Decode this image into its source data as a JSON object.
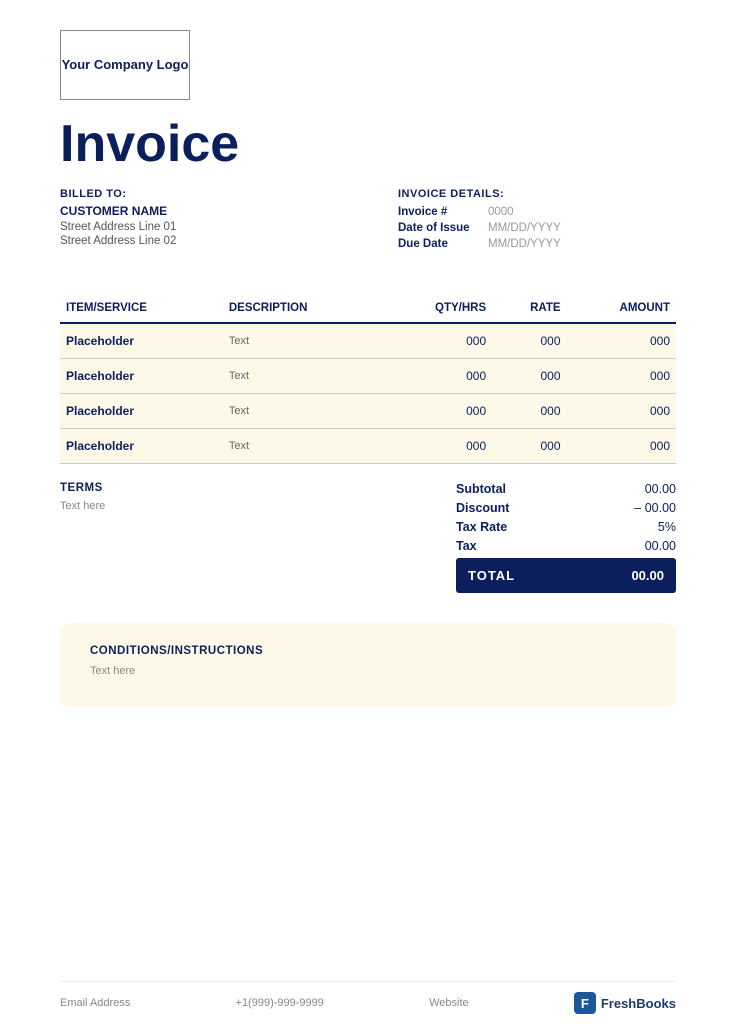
{
  "logo": {
    "text": "Your Company Logo"
  },
  "title": "Invoice",
  "billed_to": {
    "label": "BILLED TO:",
    "customer_name": "CUSTOMER NAME",
    "address_line1": "Street Address Line 01",
    "address_line2": "Street Address Line 02"
  },
  "invoice_details": {
    "label": "INVOICE DETAILS:",
    "fields": [
      {
        "key": "Invoice #",
        "value": "0000"
      },
      {
        "key": "Date of Issue",
        "value": "MM/DD/YYYY"
      },
      {
        "key": "Due Date",
        "value": "MM/DD/YYYY"
      }
    ]
  },
  "table": {
    "headers": [
      "ITEM/SERVICE",
      "DESCRIPTION",
      "QTY/HRS",
      "RATE",
      "AMOUNT"
    ],
    "rows": [
      {
        "item": "Placeholder",
        "desc": "Text",
        "qty": "000",
        "rate": "000",
        "amount": "000"
      },
      {
        "item": "Placeholder",
        "desc": "Text",
        "qty": "000",
        "rate": "000",
        "amount": "000"
      },
      {
        "item": "Placeholder",
        "desc": "Text",
        "qty": "000",
        "rate": "000",
        "amount": "000"
      },
      {
        "item": "Placeholder",
        "desc": "Text",
        "qty": "000",
        "rate": "000",
        "amount": "000"
      }
    ]
  },
  "terms": {
    "title": "TERMS",
    "text": "Text here"
  },
  "totals": {
    "subtotal_label": "Subtotal",
    "subtotal_value": "00.00",
    "discount_label": "Discount",
    "discount_value": "– 00.00",
    "tax_rate_label": "Tax Rate",
    "tax_rate_value": "5%",
    "tax_label": "Tax",
    "tax_value": "00.00",
    "total_label": "TOTAL",
    "total_value": "00.00"
  },
  "conditions": {
    "title": "CONDITIONS/INSTRUCTIONS",
    "text": "Text here"
  },
  "footer": {
    "email": "Email Address",
    "phone": "+1(999)-999-9999",
    "website": "Website",
    "brand": "FreshBooks",
    "brand_icon": "F"
  }
}
